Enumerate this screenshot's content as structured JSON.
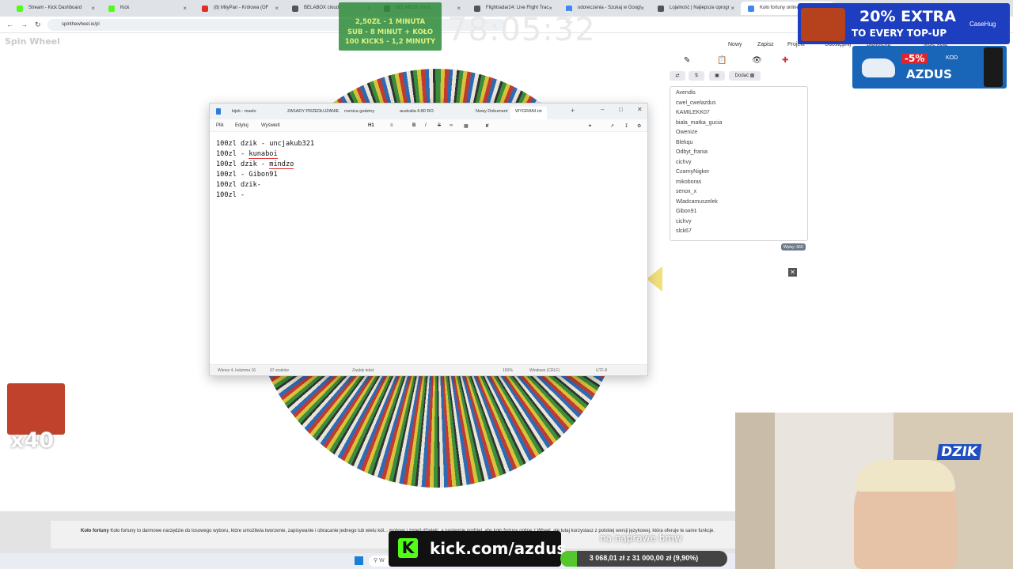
{
  "browser": {
    "tabs": [
      {
        "title": "Stream - Kick Dashboard",
        "color": "#53fc18"
      },
      {
        "title": "Kick",
        "color": "#53fc18"
      },
      {
        "title": "(8) MiiyPan - Królowa (OF",
        "color": "#e52d27"
      },
      {
        "title": "BELABOX cloud",
        "color": "#555555"
      },
      {
        "title": "BELABOX cloud",
        "color": "#555555"
      },
      {
        "title": "Flightradar24: Live Flight Trac",
        "color": "#555555"
      },
      {
        "title": "odoreczenia - Szukaj w Googl",
        "color": "#4285f4"
      },
      {
        "title": "Lojalność | Najlepsze oprogr",
        "color": "#555555"
      },
      {
        "title": "Koło fortuny online",
        "color": "#4285f4"
      }
    ],
    "url": "spinthewheel.io/pl"
  },
  "site": {
    "logo": "Spin Wheel",
    "toolbar": {
      "new": "Nowy",
      "save": "Zapisz",
      "project": "Projekt",
      "share": "Udostępnij",
      "library": "Biblioteka",
      "my_wheels": "Moje koła"
    },
    "add_button": "Dodać",
    "entries": [
      "Avendis",
      "cwel_cwelazdus",
      "KAMILEKK07",
      "biala_matka_gucia",
      "Owenize",
      "Blekqu",
      "Odbyt_frania",
      "cichvy",
      "CzarnyNigker",
      "mikoboras",
      "senox_x",
      "Wladcamuszelek",
      "Gibon91",
      "cichvy",
      "slck67"
    ],
    "entry_count": "Wpisy: 560",
    "footer": "Koło fortuny to darmowe narzędzie do losowego wyboru, które umożliwia tworzenie, zapisywanie i obracanie jednego lub wielu kół... motywy i zmień dźwięki, a następnie podziel, aby koło fortuny online z Wheel, ale tutaj korzystasz z polskiej wersji językowej, która oferuje te same funkcje.",
    "footer_bold": "Koło fortuny"
  },
  "notepad": {
    "tabs": [
      "kijek - maslo",
      "ZASADY PRZEDŁUŻANIE",
      "roznica godziny",
      "australia 6:80 RO",
      "Nowy Dokument",
      "WYGRANI.txt"
    ],
    "menu": [
      "Plik",
      "Edytuj",
      "Wyświetl"
    ],
    "lines": [
      {
        "prefix": "100zl dzik - ",
        "name": "uncjakub321",
        "spell": false
      },
      {
        "prefix": "100zl - ",
        "name": "kunaboi",
        "spell": true
      },
      {
        "prefix": "100zl dzik - ",
        "name": "mindzo",
        "spell": true
      },
      {
        "prefix": "100zl - ",
        "name": "Gibon91",
        "spell": false
      },
      {
        "prefix": "100zl dzik-",
        "name": "",
        "spell": false
      },
      {
        "prefix": "100zl - ",
        "name": "",
        "spell": false
      }
    ],
    "status": {
      "position": "Wiersz 4, kolumna 16",
      "chars": "97 znaków",
      "format": "Zwykły tekst",
      "zoom": "150%",
      "line_ending": "Windows (CRLF)",
      "encoding": "UTF-8"
    }
  },
  "overlay": {
    "timer_rules": [
      "2,50ZŁ - 1 MINUTA",
      "SUB - 8 MINUT + KOŁO",
      "100 KICKS - 1,2 MINUTY"
    ],
    "timer": "78:05:32",
    "timer_sub": "2",
    "case_ad_big": "20% EXTRA",
    "case_ad_small": "TO EVERY TOP-UP",
    "case_ad_brand": "CaseHug",
    "dzik_code_pct": "-5%",
    "dzik_code_label": "KOD",
    "dzik_code": "AZDUS",
    "emote_multiplier": "x40",
    "kick_url": "kick.com/azdus",
    "kick_letter": "K",
    "goal_label": "na naprawe bmw",
    "goal_text": "3 068,01 zł z 31 000,00 zł (9,90%)",
    "goal_fraction": 0.099,
    "cam_logo": "DZIK",
    "taskbar_search": "W"
  }
}
